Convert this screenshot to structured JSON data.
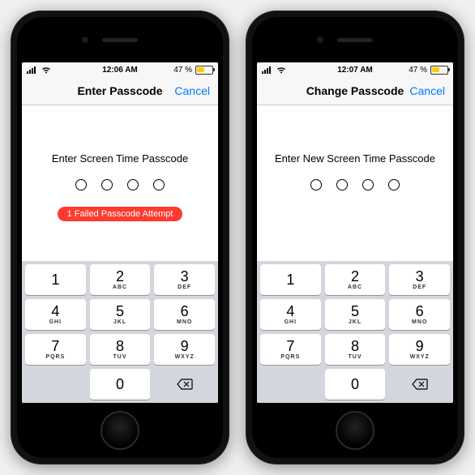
{
  "phones": [
    {
      "status": {
        "time": "12:06 AM",
        "battery_pct": "47 %"
      },
      "nav": {
        "title": "Enter Passcode",
        "cancel": "Cancel"
      },
      "prompt": "Enter Screen Time Passcode",
      "error": "1 Failed Passcode Attempt",
      "show_error": true
    },
    {
      "status": {
        "time": "12:07 AM",
        "battery_pct": "47 %"
      },
      "nav": {
        "title": "Change Passcode",
        "cancel": "Cancel"
      },
      "prompt": "Enter New Screen Time Passcode",
      "error": "",
      "show_error": false
    }
  ],
  "keypad": [
    [
      {
        "n": "1",
        "l": ""
      },
      {
        "n": "2",
        "l": "ABC"
      },
      {
        "n": "3",
        "l": "DEF"
      }
    ],
    [
      {
        "n": "4",
        "l": "GHI"
      },
      {
        "n": "5",
        "l": "JKL"
      },
      {
        "n": "6",
        "l": "MNO"
      }
    ],
    [
      {
        "n": "7",
        "l": "PQRS"
      },
      {
        "n": "8",
        "l": "TUV"
      },
      {
        "n": "9",
        "l": "WXYZ"
      }
    ]
  ],
  "zero": {
    "n": "0",
    "l": ""
  }
}
